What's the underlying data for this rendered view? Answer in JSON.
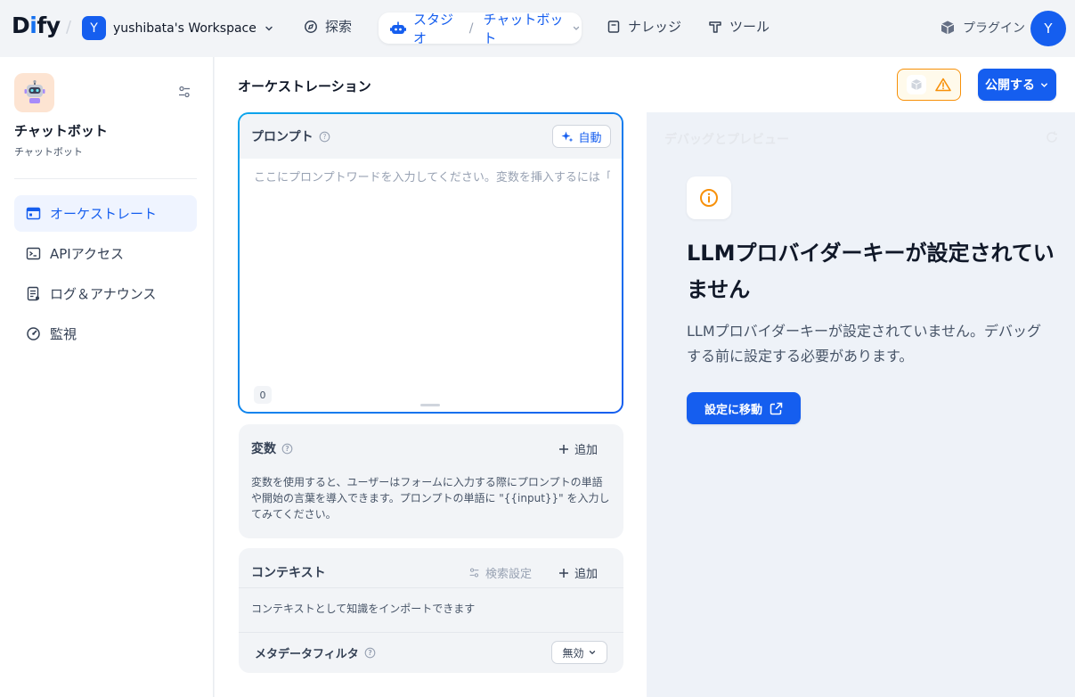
{
  "topbar": {
    "logo": {
      "prefix": "D",
      "i": "i",
      "suffix": "fy"
    },
    "workspace": {
      "initial": "Y",
      "name": "yushibata's Workspace"
    },
    "nav": {
      "explore": "探索",
      "studio": "スタジオ",
      "app_switch": "チャットボット",
      "knowledge": "ナレッジ",
      "tools": "ツール"
    },
    "plugin_label": "プラグイン",
    "user_initial": "Y"
  },
  "sidebar": {
    "app_name": "チャットボット",
    "app_type": "チャットボット",
    "items": [
      {
        "label": "オーケストレート",
        "icon": "layout-window-icon",
        "active": true
      },
      {
        "label": "APIアクセス",
        "icon": "terminal-icon",
        "active": false
      },
      {
        "label": "ログ＆アナウンス",
        "icon": "file-list-icon",
        "active": false
      },
      {
        "label": "監視",
        "icon": "dashboard-gauge-icon",
        "active": false
      }
    ]
  },
  "main": {
    "title": "オーケストレーション",
    "publish_label": "公開する",
    "prompt": {
      "title": "プロンプト",
      "auto_label": "自動",
      "placeholder": "ここにプロンプトワードを入力してください。変数を挿入するには「{」を、...",
      "count": "0"
    },
    "variables": {
      "title": "変数",
      "add_label": "追加",
      "description": "変数を使用すると、ユーザーはフォームに入力する際にプロンプトの単語や開始の言葉を導入できます。プロンプトの単語に \"{{input}}\" を入力してみてください。"
    },
    "context": {
      "title": "コンテキスト",
      "search_settings_label": "検索設定",
      "add_label": "追加",
      "description": "コンテキストとして知識をインポートできます",
      "metadata_filter_label": "メタデータフィルタ",
      "metadata_filter_value": "無効"
    }
  },
  "preview": {
    "title": "デバッグとプレビュー",
    "warning_title": "LLMプロバイダーキーが設定されていません",
    "warning_description": "LLMプロバイダーキーが設定されていません。デバッグする前に設定する必要があります。",
    "goto_label": "設定に移動"
  },
  "colors": {
    "primary": "#155eef",
    "warning": "#f79009",
    "sidebar_active_bg": "#eff4ff"
  }
}
